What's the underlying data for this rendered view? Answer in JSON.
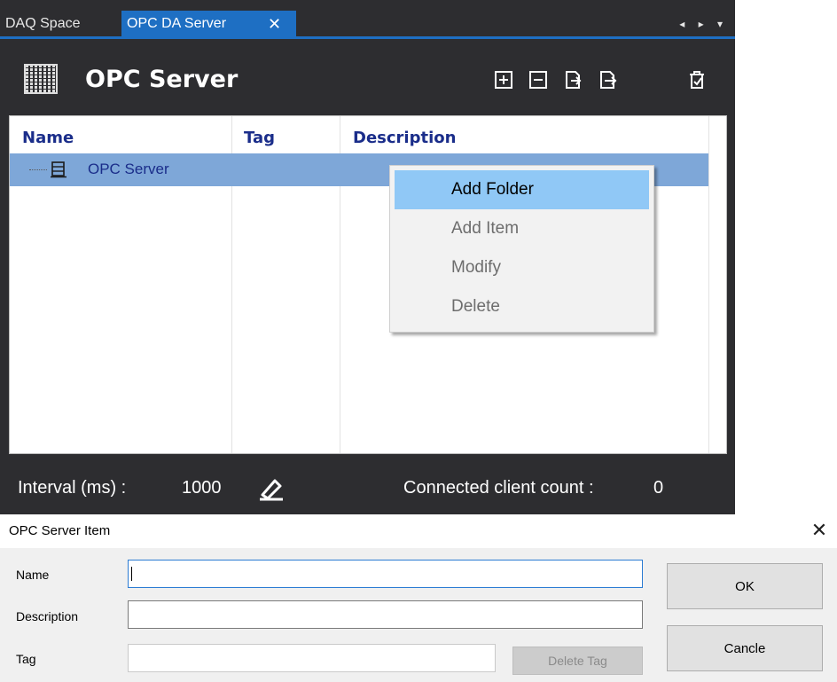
{
  "tabs": [
    {
      "label": "DAQ Space",
      "active": false
    },
    {
      "label": "OPC DA Server",
      "active": true,
      "close_glyph": "✕"
    }
  ],
  "tab_nav": "◂ ▸ ▾",
  "header": {
    "title": "OPC Server",
    "toolbar": [
      "expand-all-icon",
      "collapse-all-icon",
      "import-icon",
      "export-icon",
      "clear-icon"
    ]
  },
  "tree": {
    "columns": [
      "Name",
      "Tag",
      "Description"
    ],
    "rows": [
      {
        "name": "OPC Server",
        "tag": "",
        "description": "",
        "selected": true
      }
    ]
  },
  "context_menu": {
    "items": [
      {
        "label": "Add Folder",
        "enabled": true
      },
      {
        "label": "Add Item",
        "enabled": false
      },
      {
        "label": "Modify",
        "enabled": false
      },
      {
        "label": "Delete",
        "enabled": false
      }
    ]
  },
  "status": {
    "interval_label": "Interval (ms) :",
    "interval_value": "1000",
    "client_label": "Connected client count :",
    "client_value": "0"
  },
  "dialog": {
    "title": "OPC Server Item",
    "close_glyph": "✕",
    "name_label": "Name",
    "name_value": "",
    "description_label": "Description",
    "description_value": "",
    "tag_label": "Tag",
    "tag_value": "",
    "delete_tag_label": "Delete Tag",
    "ok_label": "OK",
    "cancel_label": "Cancle"
  },
  "colors": {
    "panel_bg": "#2d2d30",
    "accent": "#1e6fc3",
    "selection": "#7ea7d8",
    "menu_highlight": "#90c8f6",
    "header_text": "#1a2d8a"
  }
}
